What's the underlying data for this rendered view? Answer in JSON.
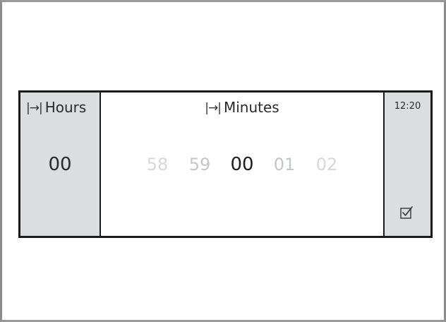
{
  "picker": {
    "hours": {
      "label": "Hours",
      "value": "00"
    },
    "minutes": {
      "label": "Minutes",
      "values": [
        "58",
        "59",
        "00",
        "01",
        "02"
      ],
      "selected": "00"
    },
    "clock": "12:20"
  },
  "icons": {
    "jump": "jump-to-icon",
    "confirm": "checkbox-confirm-icon"
  },
  "colors": {
    "side_panel": "#dcdde0",
    "border": "#1a1a1a",
    "inactive_text": "#c9cacd",
    "active_text": "#1f1f1f"
  }
}
